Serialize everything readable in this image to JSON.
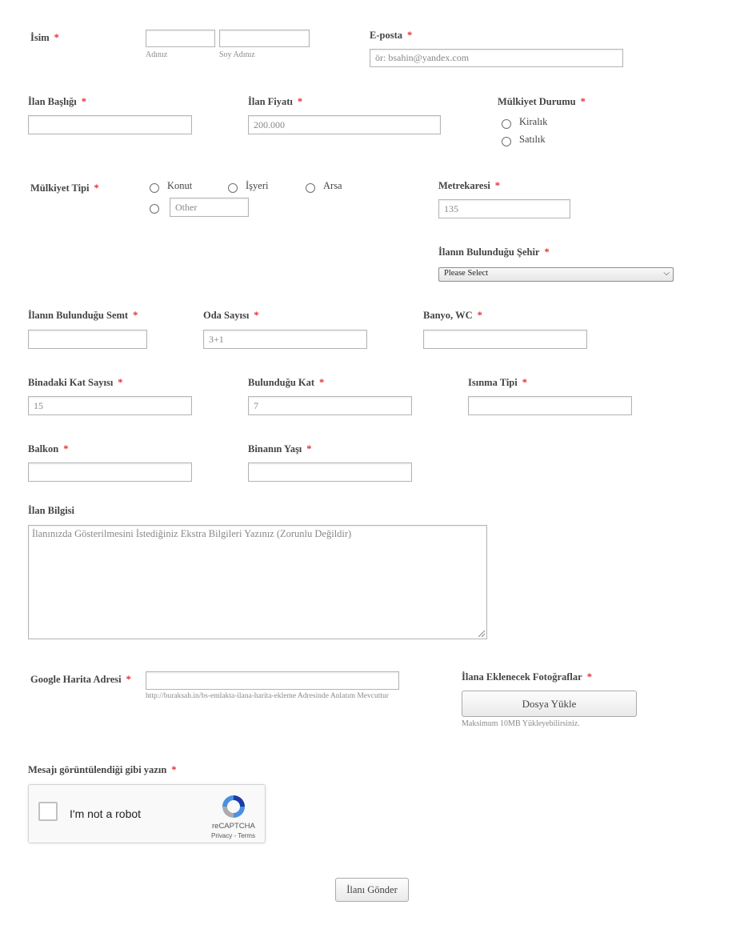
{
  "form": {
    "name": {
      "label": "İsim",
      "first_sub": "Adınız",
      "last_sub": "Soy Adınız",
      "first_value": "",
      "last_value": ""
    },
    "email": {
      "label": "E-posta",
      "placeholder": "ör: bsahin@yandex.com"
    },
    "listing_title": {
      "label": "İlan Başlığı",
      "value": ""
    },
    "price": {
      "label": "İlan Fiyatı",
      "placeholder": "200.000"
    },
    "status": {
      "label": "Mülkiyet Durumu",
      "options": [
        "Kiralık",
        "Satılık"
      ]
    },
    "property_type": {
      "label": "Mülkiyet Tipi",
      "options": [
        "Konut",
        "İşyeri",
        "Arsa"
      ],
      "other_placeholder": "Other"
    },
    "area": {
      "label": "Metrekaresi",
      "placeholder": "135"
    },
    "city": {
      "label": "İlanın Bulunduğu Şehir",
      "selected": "Please Select"
    },
    "district": {
      "label": "İlanın Bulunduğu Semt",
      "value": ""
    },
    "rooms": {
      "label": "Oda Sayısı",
      "placeholder": "3+1"
    },
    "bath": {
      "label": "Banyo, WC",
      "value": ""
    },
    "floors": {
      "label": "Binadaki Kat Sayısı",
      "placeholder": "15"
    },
    "floor": {
      "label": "Bulunduğu Kat",
      "placeholder": "7"
    },
    "heating": {
      "label": "Isınma Tipi",
      "value": ""
    },
    "balcony": {
      "label": "Balkon",
      "value": ""
    },
    "age": {
      "label": "Binanın Yaşı",
      "value": ""
    },
    "info": {
      "label": "İlan Bilgisi",
      "placeholder": "İlanınızda Gösterilmesini İstediğiniz Ekstra Bilgileri Yazınız (Zorunlu Değildir)"
    },
    "map": {
      "label": "Google Harita Adresi",
      "hint": "http://buraksah.in/bs-emlakta-ilana-harita-ekleme Adresinde Anlatım Mevcuttur"
    },
    "photos": {
      "label": "İlana Eklenecek Fotoğraflar",
      "button": "Dosya Yükle",
      "hint": "Maksimum 10MB Yükleyebilirsiniz."
    },
    "captcha": {
      "label": "Mesajı görüntülendiği gibi yazın",
      "text": "I'm not a robot",
      "brand": "reCAPTCHA",
      "links": "Privacy - Terms"
    },
    "submit": "İlanı Gönder",
    "required_mark": "*"
  },
  "colors": {
    "required": "#e8302e",
    "label": "#444444",
    "border": "#b4b4b4",
    "recaptcha_blue": "#4a90e2"
  }
}
